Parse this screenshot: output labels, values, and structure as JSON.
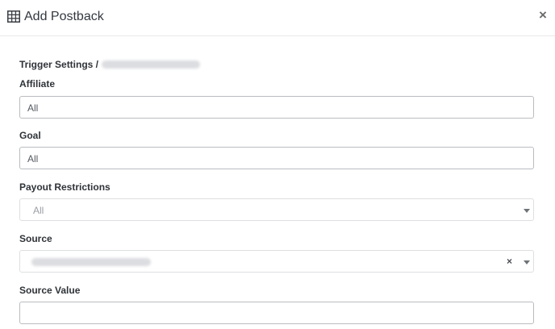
{
  "header": {
    "title": "Add Postback",
    "title_icon": "table-grid-icon",
    "close_symbol": "×"
  },
  "breadcrumb": {
    "label": "Trigger Settings /"
  },
  "form": {
    "affiliate": {
      "label": "Affiliate",
      "value": "All"
    },
    "goal": {
      "label": "Goal",
      "value": "All"
    },
    "payout_restrictions": {
      "label": "Payout Restrictions",
      "value": "All"
    },
    "source": {
      "label": "Source",
      "clear_symbol": "×"
    },
    "source_value": {
      "label": "Source Value",
      "value": ""
    }
  }
}
